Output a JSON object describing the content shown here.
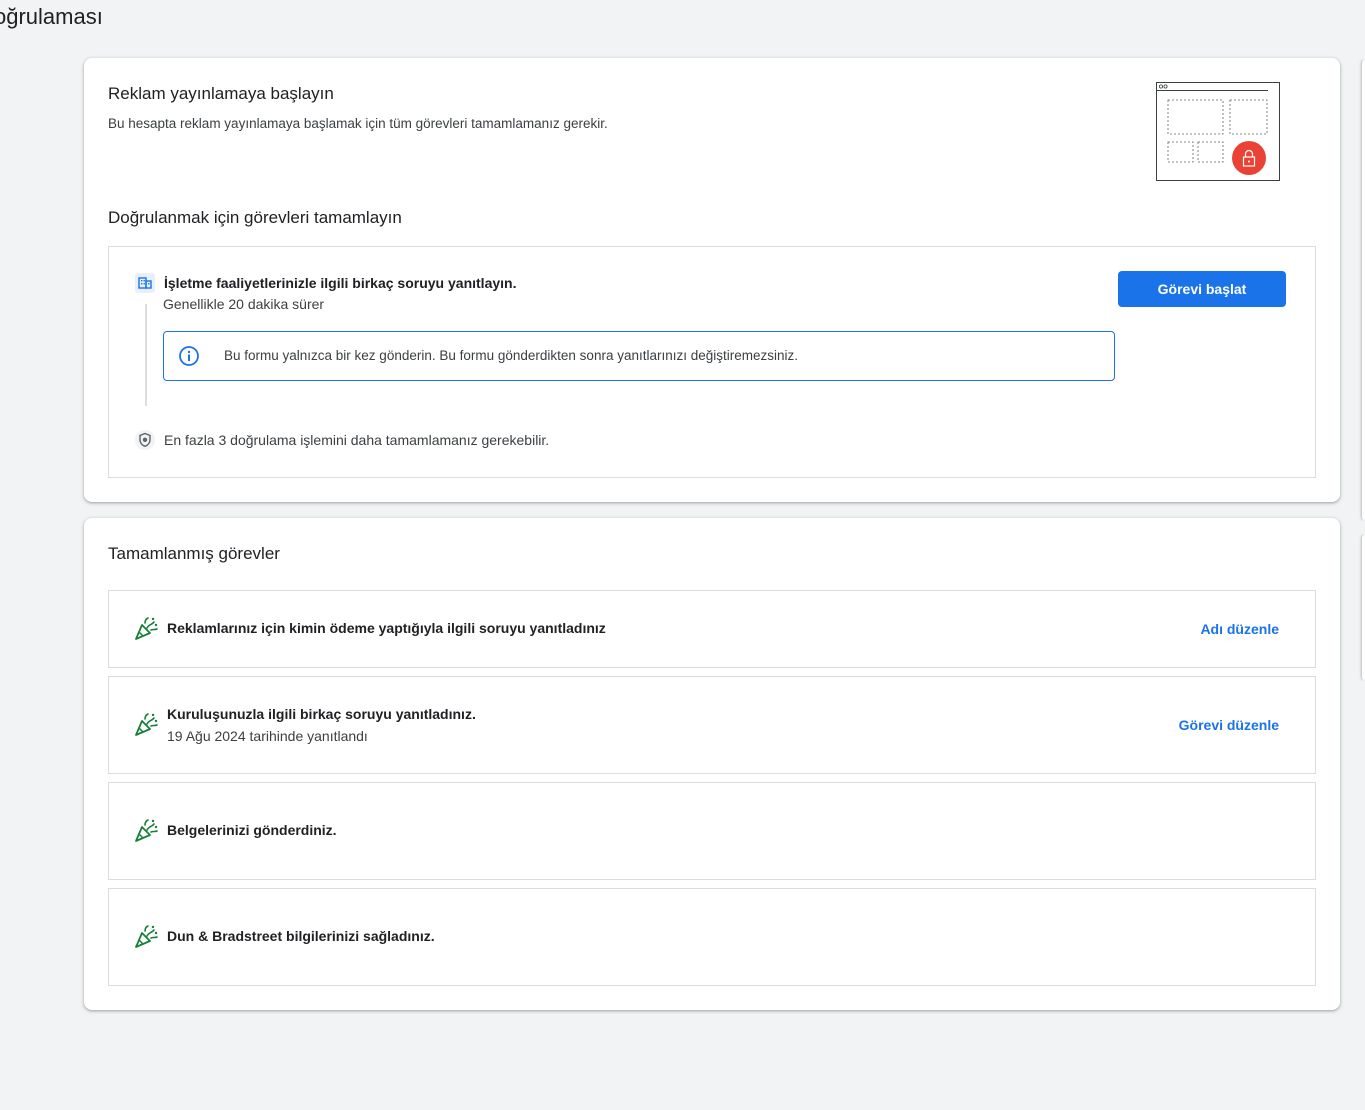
{
  "page": {
    "title": "oğrulaması"
  },
  "intro": {
    "title": "Reklam yayınlamaya başlayın",
    "description": "Bu hesapta reklam yayınlamaya başlamak için tüm görevleri tamamlamanız gerekir."
  },
  "verification": {
    "section_title": "Doğrulanmak için görevleri tamamlayın",
    "task": {
      "icon": "building-icon",
      "title": "İşletme faaliyetlerinizle ilgili birkaç soruyu yanıtlayın.",
      "duration": "Genellikle 20 dakika sürer",
      "button_label": "Görevi başlat",
      "info_icon": "info-icon",
      "info_text": "Bu formu yalnızca bir kez gönderin. Bu formu gönderdikten sonra yanıtlarınızı değiştiremezsiniz."
    },
    "remaining": {
      "icon": "shield-icon",
      "text": "En fazla 3 doğrulama işlemini daha tamamlamanız gerekebilir."
    }
  },
  "completed": {
    "section_title": "Tamamlanmış görevler",
    "items": [
      {
        "icon": "party-popper-icon",
        "title": "Reklamlarınız için kimin ödeme yaptığıyla ilgili soruyu yanıtladınız",
        "subtitle": "",
        "action": "Adı düzenle"
      },
      {
        "icon": "party-popper-icon",
        "title": "Kuruluşunuzla ilgili birkaç soruyu yanıtladınız.",
        "subtitle": "19 Ağu 2024 tarihinde yanıtlandı",
        "action": "Görevi düzenle"
      },
      {
        "icon": "party-popper-icon",
        "title": "Belgelerinizi gönderdiniz.",
        "subtitle": "",
        "action": ""
      },
      {
        "icon": "party-popper-icon",
        "title": "Dun & Bradstreet bilgilerinizi sağladınız.",
        "subtitle": "",
        "action": ""
      }
    ]
  },
  "colors": {
    "primary": "#1a73e8",
    "success_icon": "#188038",
    "lock_red": "#ea4335",
    "background": "#f1f3f4"
  }
}
